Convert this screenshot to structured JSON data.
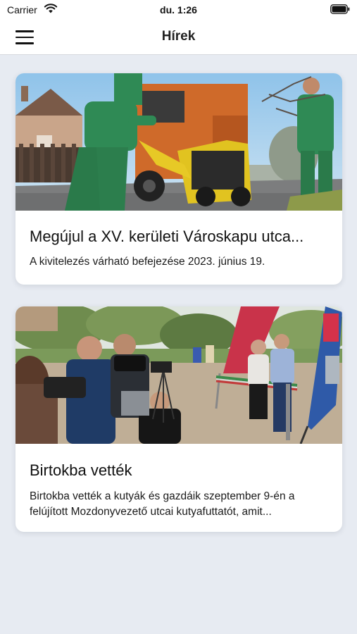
{
  "status_bar": {
    "carrier": "Carrier",
    "time": "du. 1:26",
    "icons": [
      "wifi-icon",
      "battery-icon"
    ]
  },
  "nav": {
    "title": "Hírek",
    "menu_icon": "hamburger-menu-icon"
  },
  "articles": [
    {
      "headline": "Megújul a XV. kerületi Városkapu utca...",
      "summary": "A kivitelezés várható befejezése 2023. június 19.",
      "image": "road-construction-photo"
    },
    {
      "headline": "Birtokba vették",
      "summary": "Birtokba vették a kutyák és gazdáik szeptember 9-én a felújított Mozdonyvezető utcai kutyafuttatót, amit...",
      "image": "ribbon-cutting-photo"
    }
  ],
  "colors": {
    "background": "#e7ebf2",
    "card": "#ffffff",
    "text": "#111111"
  }
}
